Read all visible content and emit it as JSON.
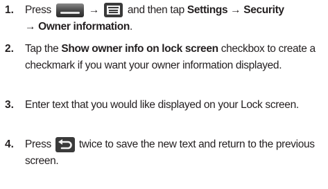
{
  "steps": [
    {
      "number": "1.",
      "t1": "Press",
      "home_icon": "home-key-icon",
      "arrow1": "→",
      "menu_icon": "menu-key-icon",
      "t2": "and then tap",
      "b1": "Settings → Security",
      "b2": "→ Owner information",
      "t3": "."
    },
    {
      "number": "2.",
      "t1": "Tap the",
      "b1": "Show owner info on lock screen",
      "t2": "checkbox to create a checkmark if you want your owner information displayed."
    },
    {
      "number": "3.",
      "t1": "Enter text that you would like displayed on your Lock screen."
    },
    {
      "number": "4.",
      "t1": "Press",
      "back_icon": "back-key-icon",
      "t2": "twice to save the new text and return to the previous screen."
    }
  ],
  "colors": {
    "text": "#231f20",
    "icon_dark": "#3a3a3a",
    "icon_light": "#f4f4f4"
  }
}
